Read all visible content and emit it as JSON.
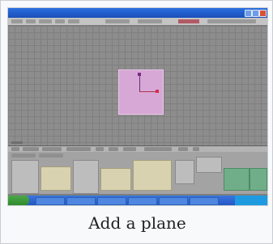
{
  "caption": "Add a plane",
  "colors": {
    "viewport": "#8d8d8d",
    "plane": "#d7a8d6",
    "x_axis": "#b0304a",
    "y_axis": "#6b2a7a",
    "taskbar": "#2456c4",
    "start_button": "#2f8a2c"
  }
}
